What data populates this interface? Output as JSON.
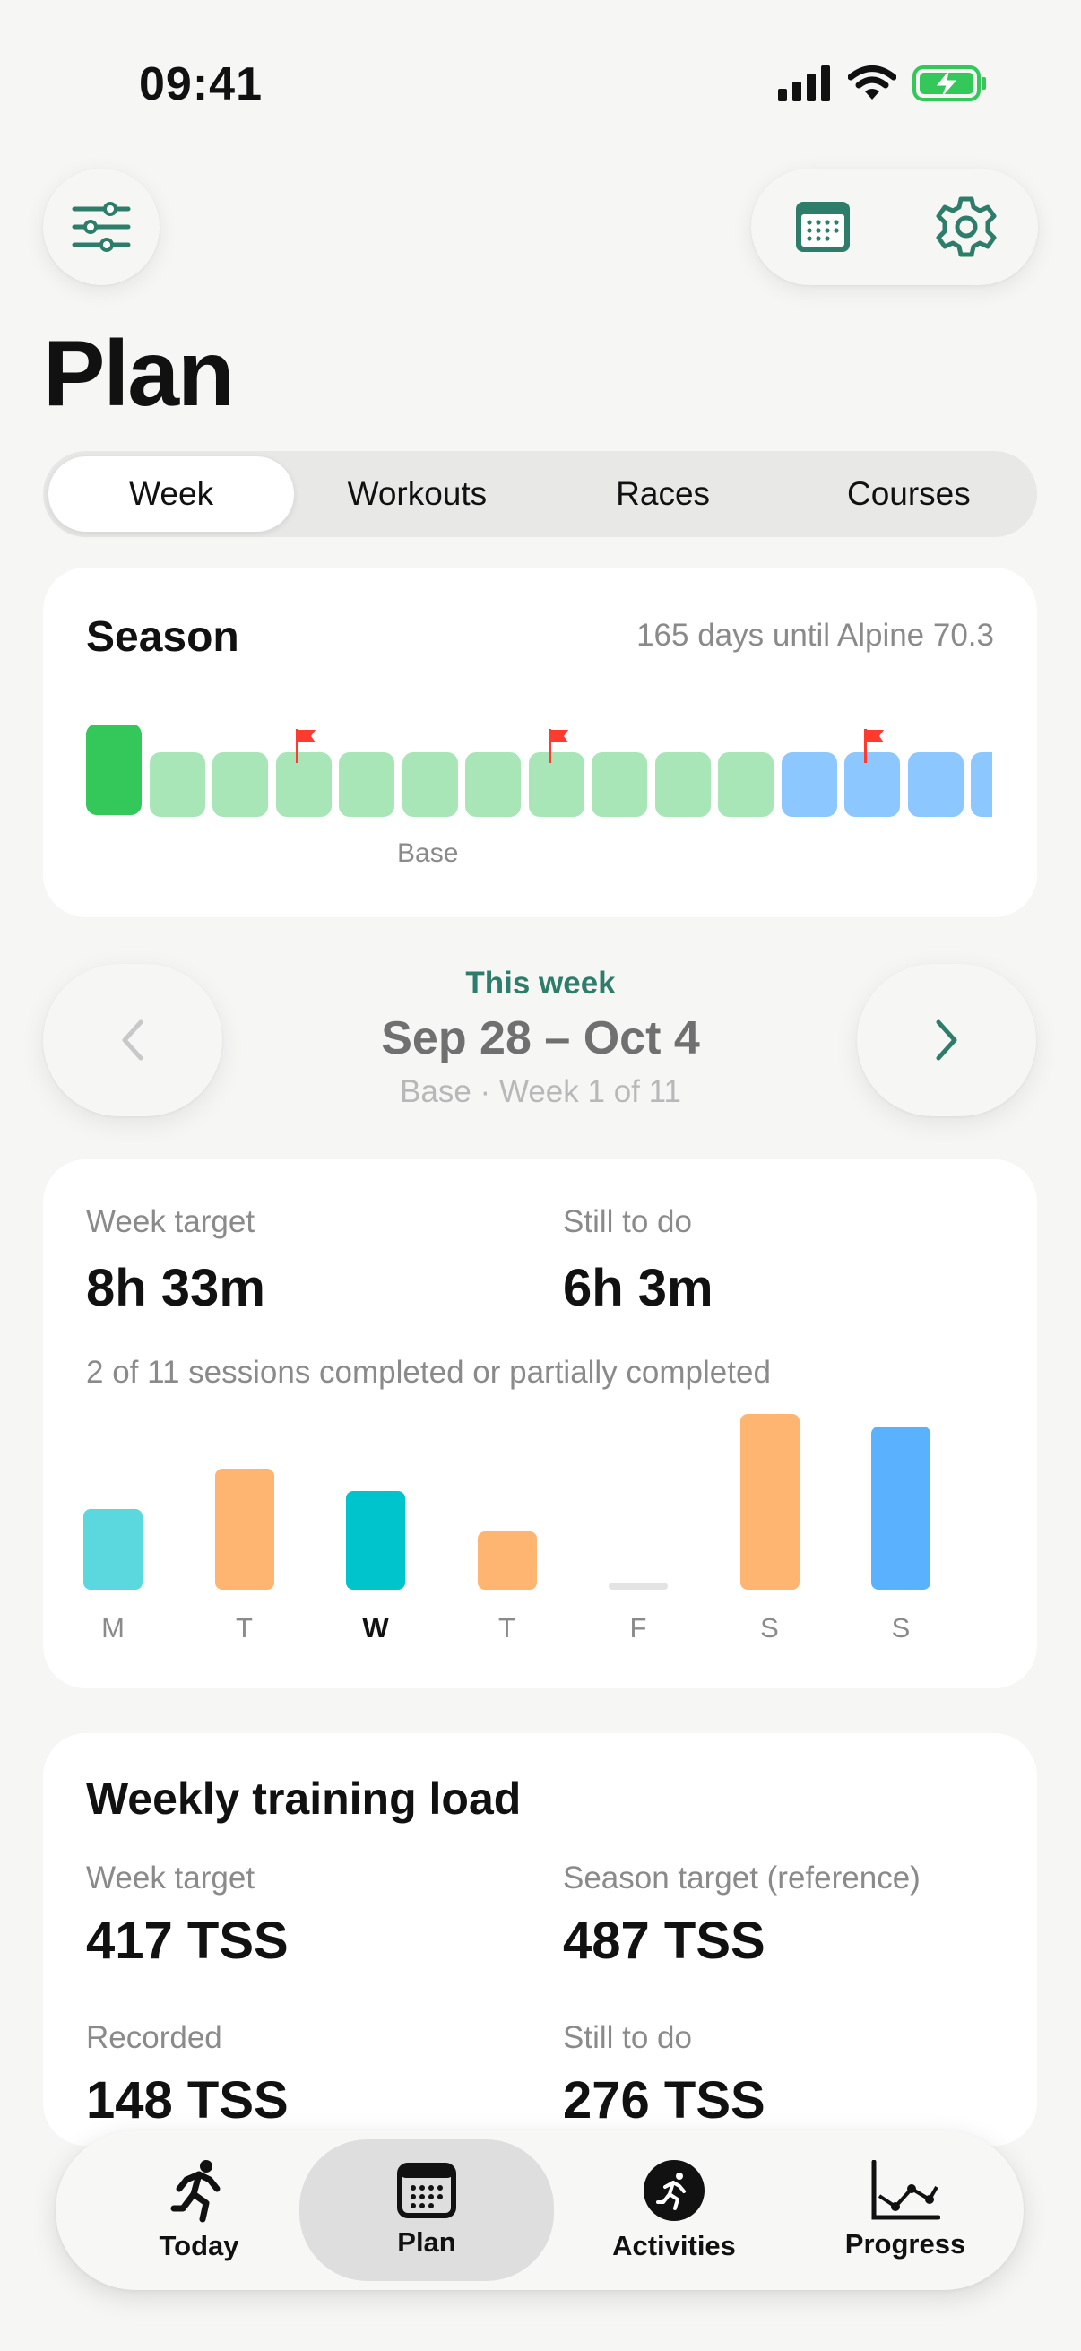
{
  "status_bar": {
    "time": "09:41"
  },
  "header": {
    "filter_icon": "sliders-icon",
    "calendar_icon": "calendar-icon",
    "settings_icon": "gear-icon"
  },
  "page": {
    "title": "Plan"
  },
  "segments": {
    "items": [
      "Week",
      "Workouts",
      "Races",
      "Courses"
    ],
    "active": "Week"
  },
  "season": {
    "title": "Season",
    "countdown": "165 days until Alpine 70.3",
    "phase_label": "Base",
    "colors": {
      "current": "#34c759",
      "base": "#a8e6b8",
      "build": "#8cc8ff",
      "flag": "#ff3b30"
    }
  },
  "week_nav": {
    "label": "This week",
    "range": "Sep 28 – Oct 4",
    "phase": "Base · Week 1 of 11"
  },
  "week_summary": {
    "target_label": "Week target",
    "target_value": "8h 33m",
    "todo_label": "Still to do",
    "todo_value": "6h 3m",
    "sessions_text": "2 of 11 sessions completed or partially completed",
    "days": [
      "M",
      "T",
      "W",
      "T",
      "F",
      "S",
      "S"
    ],
    "today_index": 2,
    "day_load": [
      0.46,
      0.69,
      0.56,
      0.33,
      0,
      1.0,
      0.93
    ],
    "day_colors": [
      "#5ad8de",
      "#ffb572",
      "#00c4cc",
      "#ffb572",
      "#e3e3e3",
      "#ffb572",
      "#5ab2ff"
    ]
  },
  "training_load": {
    "title": "Weekly training load",
    "week_target_label": "Week target",
    "week_target_value": "417 TSS",
    "season_target_label": "Season target (reference)",
    "season_target_value": "487 TSS",
    "recorded_label": "Recorded",
    "recorded_value": "148 TSS",
    "todo_label": "Still to do",
    "todo_value": "276 TSS"
  },
  "tabbar": {
    "items": [
      {
        "label": "Today",
        "icon": "running-person-icon"
      },
      {
        "label": "Plan",
        "icon": "calendar-icon"
      },
      {
        "label": "Activities",
        "icon": "activity-circle-icon"
      },
      {
        "label": "Progress",
        "icon": "line-chart-icon"
      }
    ],
    "active": "Plan"
  }
}
